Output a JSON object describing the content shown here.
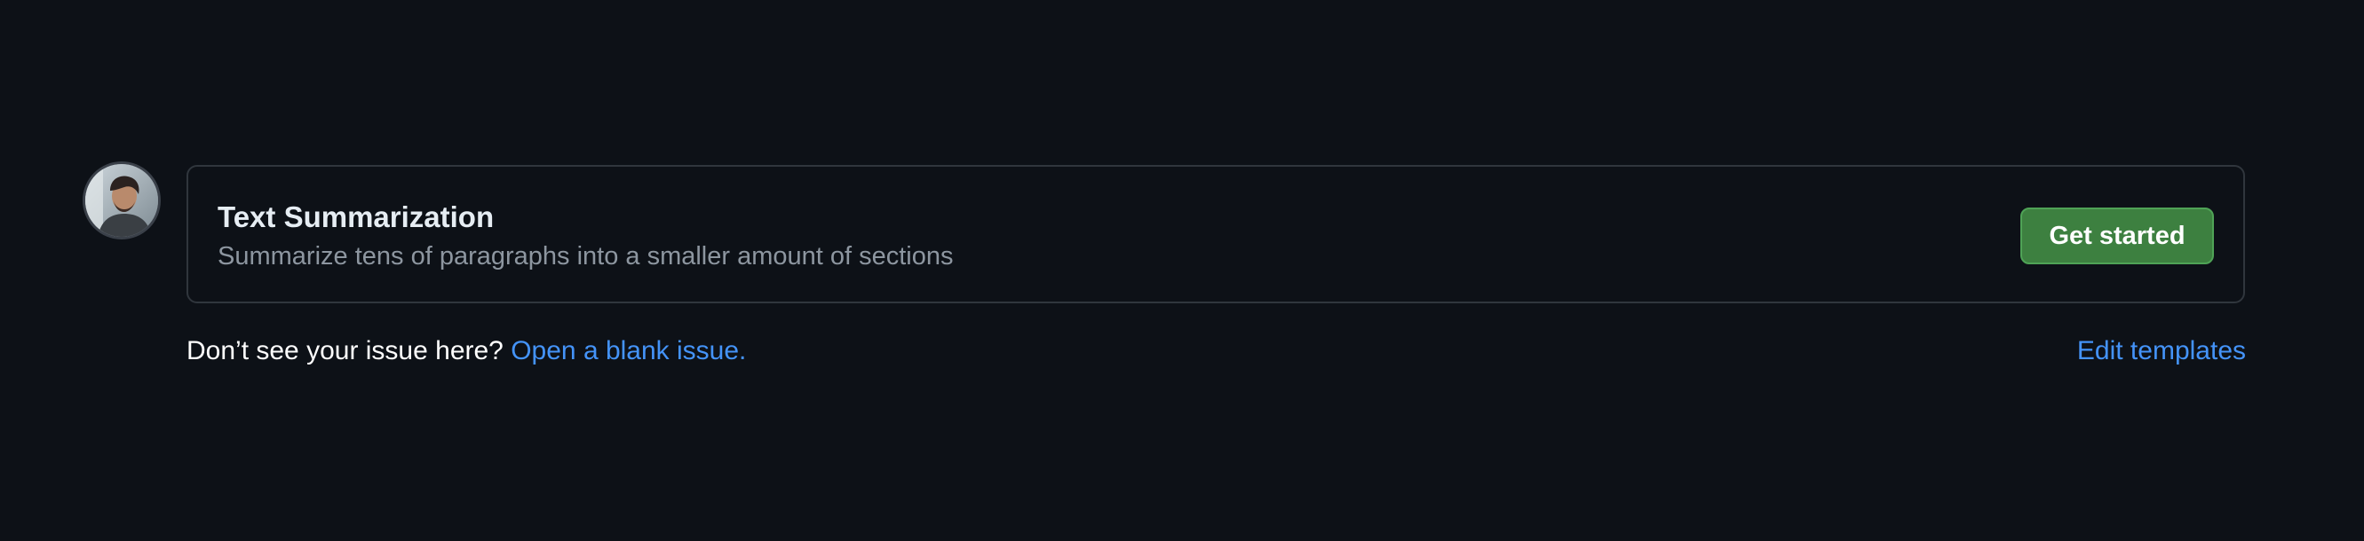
{
  "template": {
    "title": "Text Summarization",
    "description": "Summarize tens of paragraphs into a smaller amount of sections",
    "button_label": "Get started"
  },
  "footer": {
    "prompt_text": "Don’t see your issue here?",
    "blank_issue_link": "Open a blank issue.",
    "edit_templates_link": "Edit templates"
  },
  "icons": {
    "avatar": "user-avatar"
  },
  "colors": {
    "background": "#0d1117",
    "border": "#30363d",
    "button": "#3d8040",
    "link": "#4493f8",
    "muted_text": "#8d96a0"
  }
}
